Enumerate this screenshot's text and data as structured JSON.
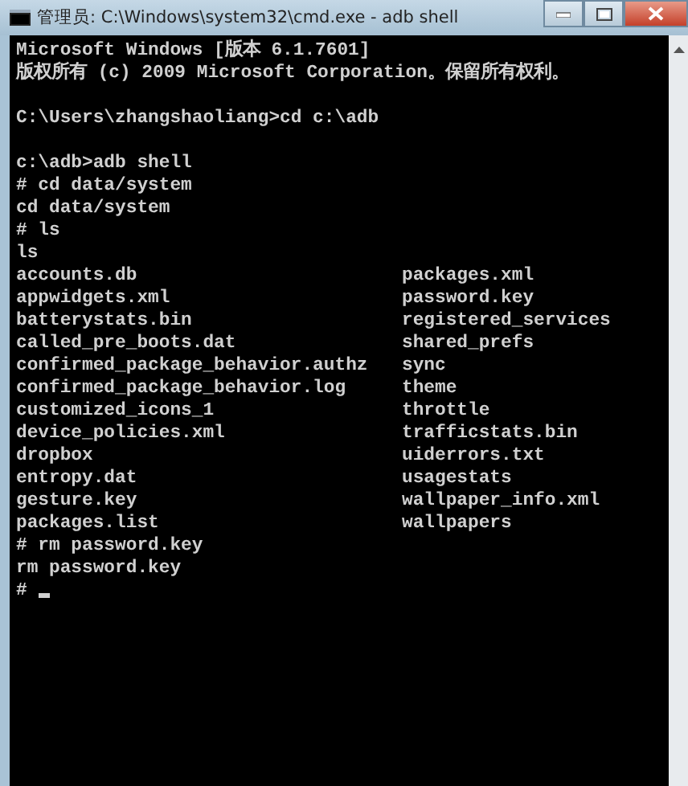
{
  "window": {
    "title": "管理员: C:\\Windows\\system32\\cmd.exe - adb  shell"
  },
  "console": {
    "lines": [
      {
        "kind": "text",
        "text": "Microsoft Windows [版本 6.1.7601]"
      },
      {
        "kind": "text",
        "text": "版权所有 (c) 2009 Microsoft Corporation。保留所有权利。"
      },
      {
        "kind": "blank"
      },
      {
        "kind": "text",
        "text": "C:\\Users\\zhangshaoliang>cd c:\\adb"
      },
      {
        "kind": "blank"
      },
      {
        "kind": "text",
        "text": "c:\\adb>adb shell"
      },
      {
        "kind": "text",
        "text": "# cd data/system"
      },
      {
        "kind": "text",
        "text": "cd data/system"
      },
      {
        "kind": "text",
        "text": "# ls"
      },
      {
        "kind": "text",
        "text": "ls"
      },
      {
        "kind": "columns",
        "left": "accounts.db",
        "right": "packages.xml"
      },
      {
        "kind": "columns",
        "left": "appwidgets.xml",
        "right": "password.key"
      },
      {
        "kind": "columns",
        "left": "batterystats.bin",
        "right": "registered_services"
      },
      {
        "kind": "columns",
        "left": "called_pre_boots.dat",
        "right": "shared_prefs"
      },
      {
        "kind": "columns",
        "left": "confirmed_package_behavior.authz",
        "right": "sync"
      },
      {
        "kind": "columns",
        "left": "confirmed_package_behavior.log",
        "right": "theme"
      },
      {
        "kind": "columns",
        "left": "customized_icons_1",
        "right": "throttle"
      },
      {
        "kind": "columns",
        "left": "device_policies.xml",
        "right": "trafficstats.bin"
      },
      {
        "kind": "columns",
        "left": "dropbox",
        "right": "uiderrors.txt"
      },
      {
        "kind": "columns",
        "left": "entropy.dat",
        "right": "usagestats"
      },
      {
        "kind": "columns",
        "left": "gesture.key",
        "right": "wallpaper_info.xml"
      },
      {
        "kind": "columns",
        "left": "packages.list",
        "right": "wallpapers"
      },
      {
        "kind": "text",
        "text": "# rm password.key"
      },
      {
        "kind": "text",
        "text": "rm password.key"
      },
      {
        "kind": "prompt",
        "text": "#"
      }
    ]
  }
}
